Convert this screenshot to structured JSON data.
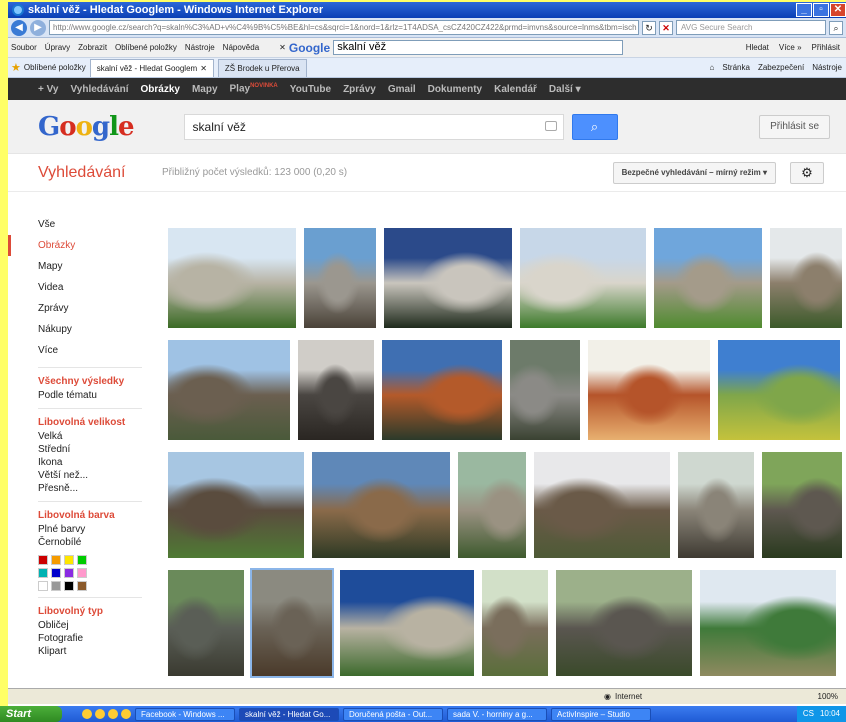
{
  "browser": {
    "title": "skalní věž - Hledat Googlem - Windows Internet Explorer",
    "address": "http://www.google.cz/search?q=skaln%C3%AD+v%C4%9B%C5%BE&hl=cs&sqrci=1&nord=1&rlz=1T4ADSA_csCZ420CZ422&prmd=imvns&source=lnms&tbm=isch",
    "avg_placeholder": "AVG Secure Search",
    "menu": [
      "Soubor",
      "Úpravy",
      "Zobrazit",
      "Oblíbené položky",
      "Nástroje",
      "Nápověda"
    ],
    "google_toolbar_query": "skalní věž",
    "toolbar_right": {
      "search": "Hledat",
      "more": "Více »",
      "login": "Přihlásit"
    },
    "favorites_label": "Oblíbené položky",
    "tabs": [
      "skalní věž - Hledat Googlem",
      "ZŠ Brodek u Přerova"
    ],
    "tools": [
      "Stránka",
      "Zabezpečení",
      "Nástroje"
    ],
    "status_zone": "Internet",
    "status_zoom": "100%"
  },
  "gbar": {
    "items": [
      "+ Vy",
      "Vyhledávání",
      "Obrázky",
      "Mapy",
      "Play",
      "YouTube",
      "Zprávy",
      "Gmail",
      "Dokumenty",
      "Kalendář",
      "Další ▾"
    ],
    "badge": "NOVINKA"
  },
  "header": {
    "query": "skalní věž",
    "signin": "Přihlásit se"
  },
  "results": {
    "section": "Vyhledávání",
    "count": "Přibližný počet výsledků: 123 000 (0,20 s)",
    "safe_search": "Bezpečné vyhledávání – mírný režim ▾"
  },
  "sidebar": {
    "types": [
      "Vše",
      "Obrázky",
      "Mapy",
      "Videa",
      "Zprávy",
      "Nákupy",
      "Více"
    ],
    "all_results": "Všechny výsledky",
    "by_topic": "Podle tématu",
    "size_h": "Libovolná velikost",
    "sizes": [
      "Velká",
      "Střední",
      "Ikona",
      "Větší než...",
      "Přesně..."
    ],
    "color_h": "Libovolná barva",
    "colors": [
      "Plné barvy",
      "Černobílé"
    ],
    "swatches": [
      "#cc0000",
      "#f59b00",
      "#ffe600",
      "#00cc00",
      "#00b2b2",
      "#0000cc",
      "#8a2be2",
      "#ff99cc",
      "#ffffff",
      "#999999",
      "#000000",
      "#8b5a2b"
    ],
    "type_h": "Libovolný typ",
    "types2": [
      "Obličej",
      "Fotografie",
      "Klipart"
    ]
  },
  "images": [
    {
      "sky": "#d8e6f2",
      "mid": "#b7b3a4",
      "low": "#3b6b25"
    },
    {
      "sky": "#6a9fd0",
      "mid": "#9b978f",
      "low": "#4a4238"
    },
    {
      "sky": "#2b4a8a",
      "mid": "#c9c5bd",
      "low": "#1f2a1c"
    },
    {
      "sky": "#c7d7e8",
      "mid": "#d9d5cb",
      "low": "#3c7a2a"
    },
    {
      "sky": "#6fa6dc",
      "mid": "#a49b8a",
      "low": "#4f8b2f"
    },
    {
      "sky": "#e4e8ea",
      "mid": "#8c7f6c",
      "low": "#3c5a2a"
    },
    {
      "sky": "#9fc2e4",
      "mid": "#6b5f50",
      "low": "#4a5a3a"
    },
    {
      "sky": "#d0cdc8",
      "mid": "#4a4642",
      "low": "#2a2622"
    },
    {
      "sky": "#3f6fb2",
      "mid": "#b45a2a",
      "low": "#2b3a2a"
    },
    {
      "sky": "#6d7b6a",
      "mid": "#8b8a86",
      "low": "#3a4232"
    },
    {
      "sky": "#f2f0e8",
      "mid": "#b5542a",
      "low": "#e8b070"
    },
    {
      "sky": "#3f7fd0",
      "mid": "#7fa64a",
      "low": "#c4c23c"
    },
    {
      "sky": "#a7c6e2",
      "mid": "#5a4c3e",
      "low": "#4f7a34"
    },
    {
      "sky": "#5f88b8",
      "mid": "#8a6a4a",
      "low": "#2e3a24"
    },
    {
      "sky": "#9ab8a0",
      "mid": "#9a9282",
      "low": "#3e5a2e"
    },
    {
      "sky": "#e8e8ea",
      "mid": "#6a5a48",
      "low": "#4e5a36"
    },
    {
      "sky": "#cfd8d0",
      "mid": "#8a8478",
      "low": "#3e3a32"
    },
    {
      "sky": "#7fa55a",
      "mid": "#5e5850",
      "low": "#2a3a1e"
    },
    {
      "sky": "#6a8a5a",
      "mid": "#5a5e56",
      "low": "#3a3a30"
    },
    {
      "sky": "#8b8a80",
      "mid": "#6a6256",
      "low": "#4a3a2a"
    },
    {
      "sky": "#1e4c9a",
      "mid": "#b8b2a2",
      "low": "#3c6a2c"
    },
    {
      "sky": "#d2e0c8",
      "mid": "#7a6e5c",
      "low": "#5a6e3a"
    },
    {
      "sky": "#9cb08a",
      "mid": "#5a5650",
      "low": "#3a4a2a"
    },
    {
      "sky": "#dfe8f0",
      "mid": "#3f7a3a",
      "low": "#8f8a60"
    }
  ]
}
